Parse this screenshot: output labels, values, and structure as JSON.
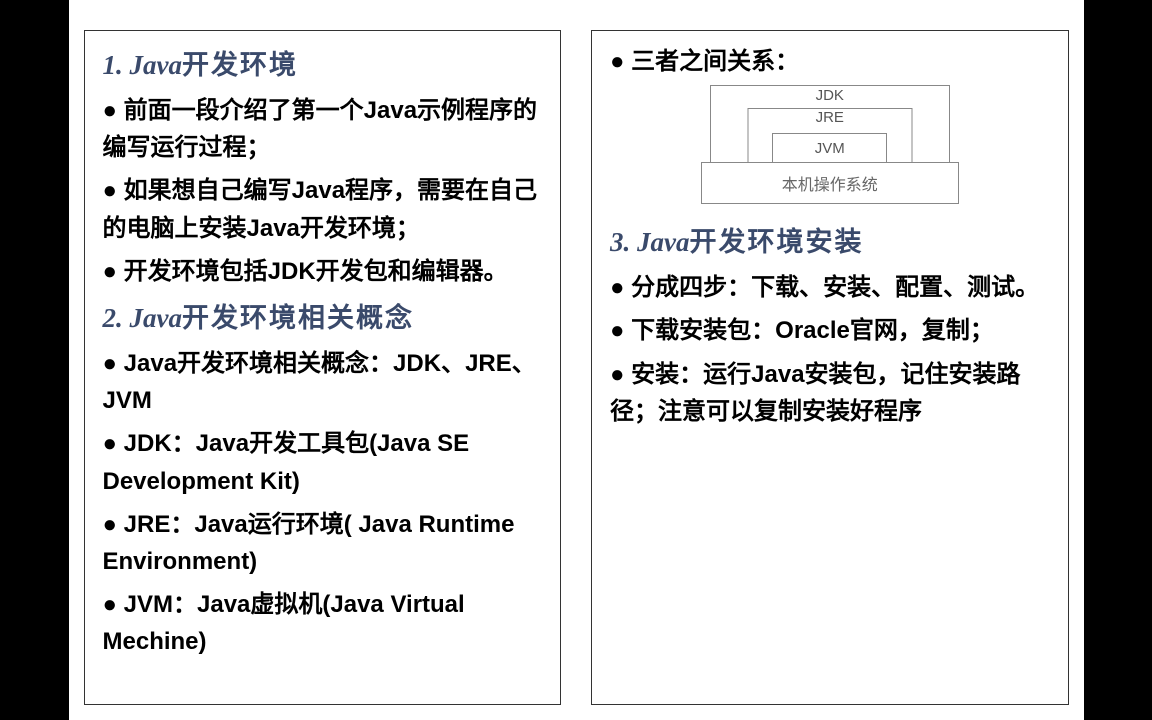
{
  "left": {
    "h1_num": "1. ",
    "h1_java": "Java",
    "h1_cn": "开发环境",
    "b1": "● 前面一段介绍了第一个Java示例程序的编写运行过程；",
    "b2": "● 如果想自己编写Java程序，需要在自己的电脑上安装Java开发环境；",
    "b3": "● 开发环境包括JDK开发包和编辑器。",
    "h2_num": "2. ",
    "h2_java": "Java",
    "h2_cn": "开发环境相关概念",
    "b4": "● Java开发环境相关概念：JDK、JRE、JVM",
    "b5": "● JDK：Java开发工具包(Java SE Development Kit)",
    "b6": "● JRE：Java运行环境( Java Runtime Environment)",
    "b7": "● JVM：Java虚拟机(Java Virtual Mechine)"
  },
  "right": {
    "b1": "● 三者之间关系：",
    "diagram": {
      "jdk": "JDK",
      "jre": "JRE",
      "jvm": "JVM",
      "os": "本机操作系统"
    },
    "h3_num": "3. ",
    "h3_java": "Java",
    "h3_cn": "开发环境安装",
    "b2": "● 分成四步：下载、安装、配置、测试。",
    "b3": "● 下载安装包：Oracle官网，复制；",
    "b4": "● 安装：运行Java安装包，记住安装路径；注意可以复制安装好程序"
  }
}
